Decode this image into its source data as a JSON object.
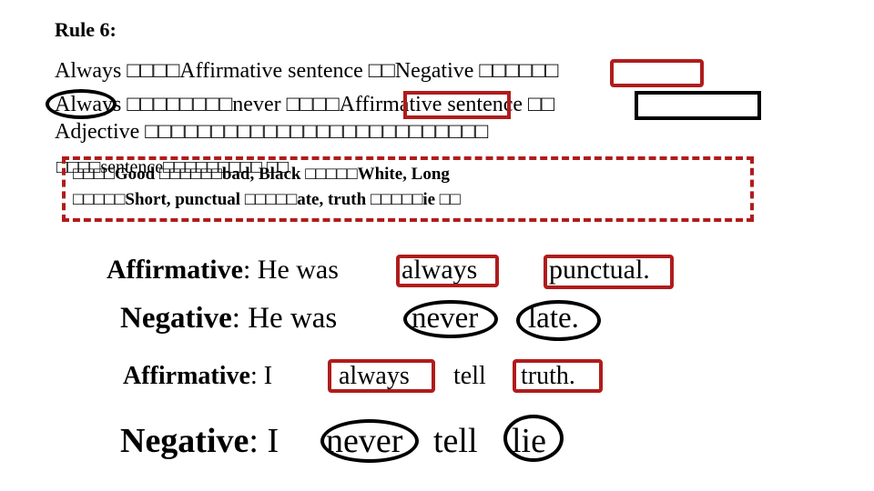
{
  "rule_title": "Rule 6:",
  "lines": {
    "l1": "Always □□□□Affirmative sentence □□Negative □□□□□□",
    "l2": "Always □□□□□□□□never □□□□Affirmative sentence □□",
    "l3": "Adjective □□□□□□□□□□□□□□□□□□□□□□□□□□",
    "l4a": "□□□□sentence□□□□□□□□□ □□",
    "l4b": "□□□□Good □□□□□□bad, Black □□□□□White, Long",
    "l5": "□□□□□Short, punctual □□□□□ate, truth □□□□□ie □□"
  },
  "examples": [
    {
      "label": "Affirmative",
      "rest": ": He was ",
      "adverb": "always",
      "word": "punctual."
    },
    {
      "label": "Negative",
      "rest": ": He was ",
      "adverb": "never",
      "word": "late."
    },
    {
      "label": "Affirmative",
      "rest": ": I ",
      "adverb": "always",
      "mid": "tell",
      "word": "truth."
    },
    {
      "label": "Negative",
      "rest": ": I ",
      "adverb": "never",
      "mid": "tell",
      "word": "lie"
    }
  ],
  "colors": {
    "accent_red": "#b01c1c",
    "outline_black": "#000000"
  }
}
